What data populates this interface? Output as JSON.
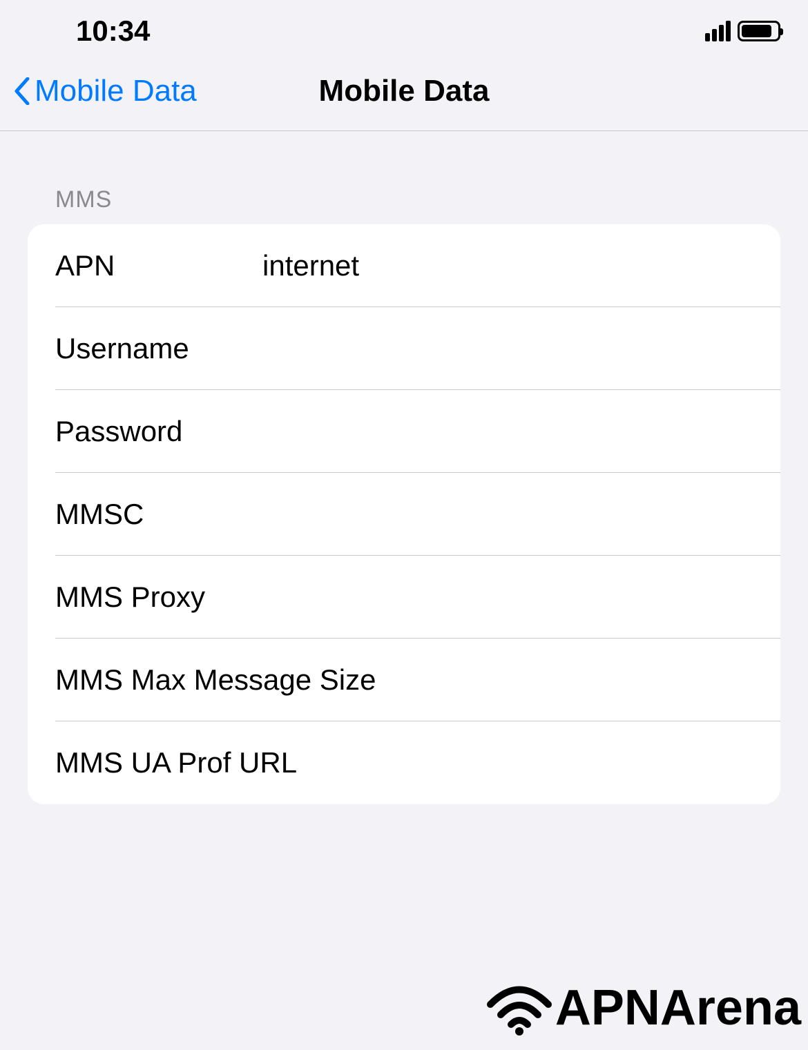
{
  "statusBar": {
    "time": "10:34"
  },
  "nav": {
    "backLabel": "Mobile Data",
    "title": "Mobile Data"
  },
  "section": {
    "header": "MMS",
    "rows": {
      "apn": {
        "label": "APN",
        "value": "internet"
      },
      "username": {
        "label": "Username",
        "value": ""
      },
      "password": {
        "label": "Password",
        "value": ""
      },
      "mmsc": {
        "label": "MMSC",
        "value": ""
      },
      "mmsproxy": {
        "label": "MMS Proxy",
        "value": ""
      },
      "mmsmax": {
        "label": "MMS Max Message Size",
        "value": ""
      },
      "mmsua": {
        "label": "MMS UA Prof URL",
        "value": ""
      }
    }
  },
  "watermark": {
    "text": "APNArena"
  }
}
